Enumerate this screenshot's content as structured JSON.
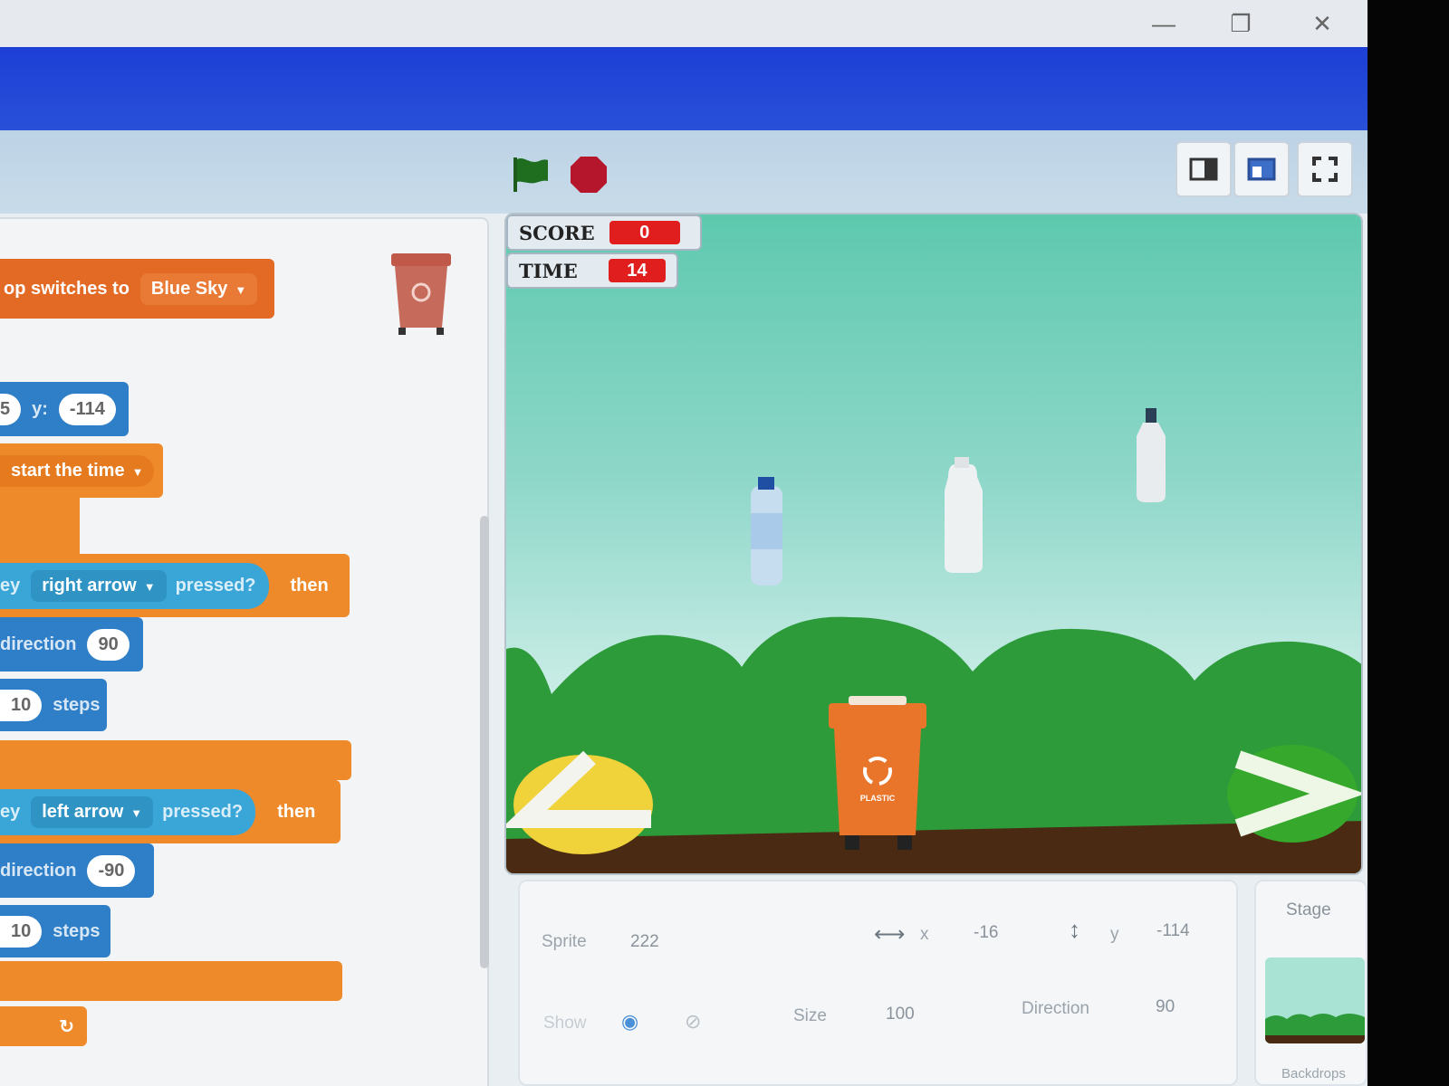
{
  "window": {
    "minimize_icon": "minimize-icon",
    "maximize_icon": "restore-icon",
    "close_icon": "close-icon"
  },
  "controls": {
    "green_flag_icon": "green-flag-icon",
    "stop_icon": "stop-icon"
  },
  "code_blocks": {
    "backdrop_text": "op switches to",
    "backdrop_value": "Blue Sky",
    "goto_x_value": "5",
    "goto_y_label": "y:",
    "goto_y_value": "-114",
    "broadcast_value": "start the time",
    "if1_key_prefix": "ey",
    "if1_key_value": "right arrow",
    "if1_pressed": "pressed?",
    "if1_then": "then",
    "dir1_text": "direction",
    "dir1_value": "90",
    "move1_value": "10",
    "move1_text": "steps",
    "if2_key_prefix": "ey",
    "if2_key_value": "left arrow",
    "if2_pressed": "pressed?",
    "if2_then": "then",
    "dir2_text": "direction",
    "dir2_value": "-90",
    "move2_value": "10",
    "move2_text": "steps",
    "loop_arrow": "↻"
  },
  "stage": {
    "score_label": "SCORE",
    "score_value": "0",
    "time_label": "TIME",
    "time_value": "14",
    "bin_label": "PLASTIC",
    "colors": {
      "sky_top": "#5ec9ae",
      "hills": "#2e9b3a",
      "ground": "#4a2a12",
      "bin": "#e8752a",
      "left_button": "#f0d23a",
      "right_button": "#36a82c",
      "monitor_value": "#e01e1e"
    }
  },
  "sprite_info": {
    "sprite_label": "Sprite",
    "sprite_name": "222",
    "x_label": "x",
    "x_value": "-16",
    "y_label": "y",
    "y_value": "-114",
    "show_label": "Show",
    "size_label": "Size",
    "size_value": "100",
    "direction_label": "Direction",
    "direction_value": "90"
  },
  "stage_panel": {
    "title": "Stage",
    "backdrops_label": "Backdrops"
  }
}
